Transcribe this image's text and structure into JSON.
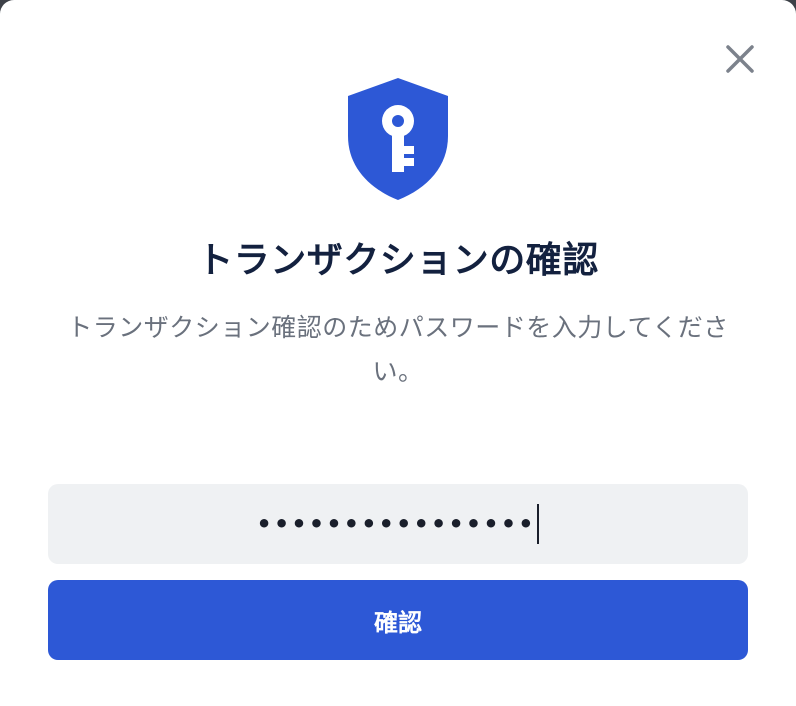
{
  "dialog": {
    "title": "トランザクションの確認",
    "description": "トランザクション確認のためパスワードを入力してください。",
    "icon": "shield-key-icon",
    "close_icon": "close-icon"
  },
  "password": {
    "masked_value": "••••••••••••••••",
    "type": "password"
  },
  "confirm": {
    "label": "確認"
  },
  "colors": {
    "accent": "#2d58d6",
    "title": "#13213f",
    "muted": "#6a717d",
    "field_bg": "#eff1f3"
  }
}
